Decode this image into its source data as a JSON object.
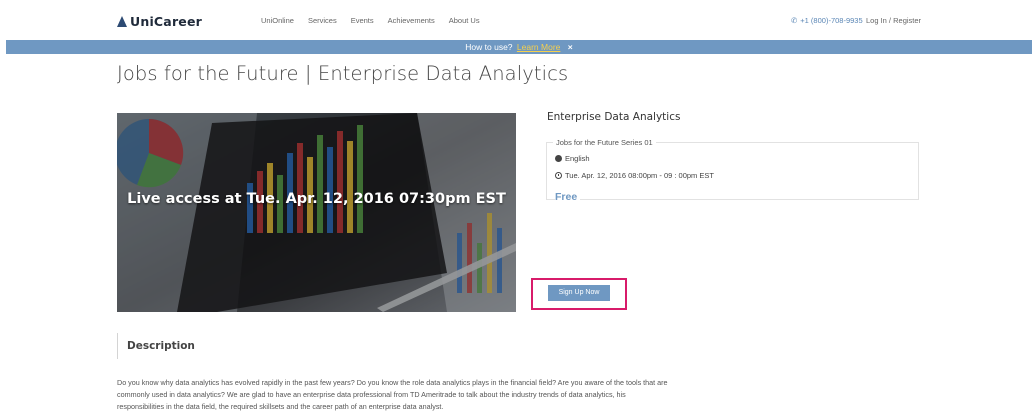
{
  "brand": {
    "name": "UniCareer"
  },
  "nav": {
    "links": [
      "UniOnline",
      "Services",
      "Events",
      "Achievements",
      "About Us"
    ],
    "phone": "+1 (800)-708-9935",
    "login": "Log In / Register"
  },
  "banner": {
    "text": "How to use?",
    "link": "Learn More",
    "close": "×"
  },
  "page": {
    "title": "Jobs for the Future | Enterprise Data Analytics"
  },
  "hero": {
    "caption": "Live access at Tue. Apr. 12, 2016 07:30pm EST"
  },
  "course": {
    "name": "Enterprise Data Analytics",
    "series": "Jobs for the Future Series 01",
    "language": "English",
    "schedule": "Tue. Apr. 12, 2016 08:00pm - 09 : 00pm EST",
    "price": "Free"
  },
  "signup": {
    "label": "Sign Up Now"
  },
  "description": {
    "heading": "Description",
    "body": "Do you know why data analytics has evolved rapidly in the past few years? Do you know the role data analytics plays in the financial field? Are you aware of the tools that are commonly used in data analytics? We are glad to have an enterprise data professional from TD Ameritrade to talk about the industry trends of data analytics, his responsibilities in the data field, the required skillsets and the career path of an enterprise data analyst."
  },
  "icons": {
    "logo": "unicareer-logo-icon",
    "phone": "phone-icon",
    "globe": "globe-icon",
    "clock": "clock-icon",
    "close": "close-icon"
  },
  "colors": {
    "accent": "#6f98c2",
    "banner_link": "#f6d04d",
    "highlight": "#d81b6a",
    "brand_dark": "#1f2a3a"
  }
}
